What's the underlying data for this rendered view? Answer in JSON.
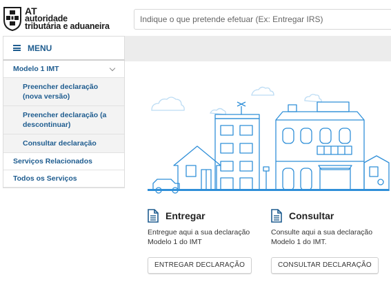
{
  "brand": {
    "logo_at": "AT",
    "logo_line1": "autoridade",
    "logo_line2": "tributária e aduaneira"
  },
  "search": {
    "placeholder": "Indique o que pretende efetuar (Ex: Entregar IRS)"
  },
  "menu": {
    "label": "MENU"
  },
  "sidebar": {
    "items": [
      {
        "label": "Modelo 1 IMT",
        "expanded": true
      },
      {
        "label": "Preencher declaração (nova versão)"
      },
      {
        "label": "Preencher declaração (a descontinuar)"
      },
      {
        "label": "Consultar declaração"
      },
      {
        "label": "Serviços Relacionados"
      },
      {
        "label": "Todos os Serviços"
      }
    ]
  },
  "cards": {
    "entregar": {
      "title": "Entregar",
      "description": "Entregue aqui a sua declaração Modelo 1 do IMT",
      "button": "ENTREGAR DECLARAÇÃO"
    },
    "consultar": {
      "title": "Consultar",
      "description": "Consulte aqui a sua declaração Modelo 1 do IMT.",
      "button": "CONSULTAR DECLARAÇÃO"
    }
  },
  "colors": {
    "brand_blue": "#1e5c8f",
    "illustration_blue": "#2f8fd8",
    "illustration_light": "#bcdcf4"
  }
}
